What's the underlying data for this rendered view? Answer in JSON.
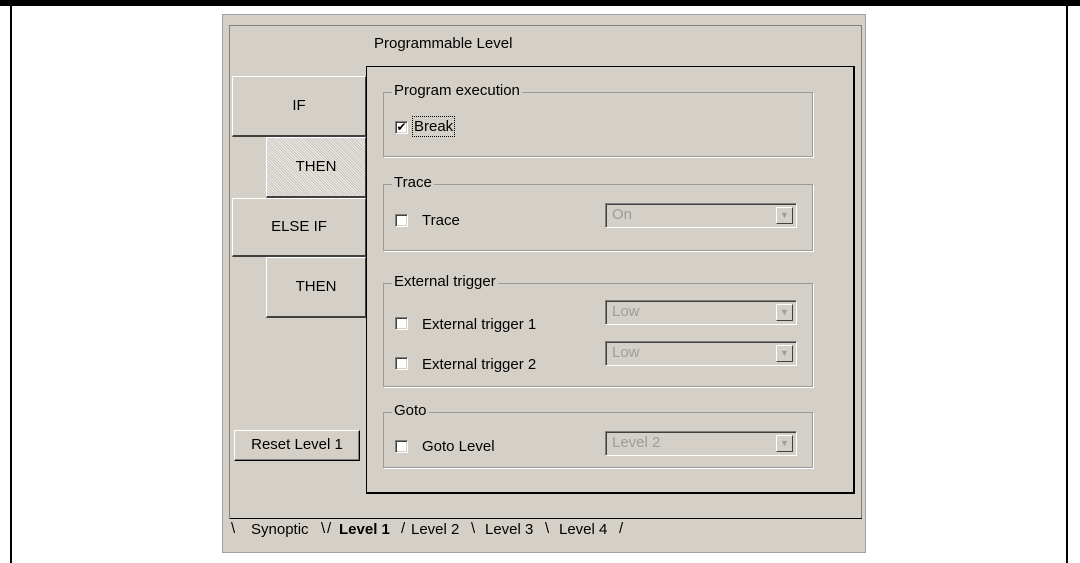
{
  "dialog": {
    "title": "Programmable Level",
    "nav": {
      "if_label": "IF",
      "then1_label": "THEN",
      "elseif_label": "ELSE IF",
      "then2_label": "THEN"
    },
    "reset_label": "Reset Level 1"
  },
  "groups": {
    "program_execution": {
      "legend": "Program execution",
      "break_label": "Break",
      "break_checked": true
    },
    "trace": {
      "legend": "Trace",
      "trace_label": "Trace",
      "trace_value": "On"
    },
    "external_trigger": {
      "legend": "External trigger",
      "trigger1_label": "External trigger 1",
      "trigger1_value": "Low",
      "trigger2_label": "External trigger 2",
      "trigger2_value": "Low"
    },
    "goto": {
      "legend": "Goto",
      "goto_label": "Goto Level",
      "goto_value": "Level 2"
    }
  },
  "tabs": [
    "Synoptic",
    "Level 1",
    "Level 2",
    "Level 3",
    "Level 4"
  ],
  "active_tab": "Level 1",
  "icons": {
    "check": "✔",
    "dropdown": "▼"
  }
}
